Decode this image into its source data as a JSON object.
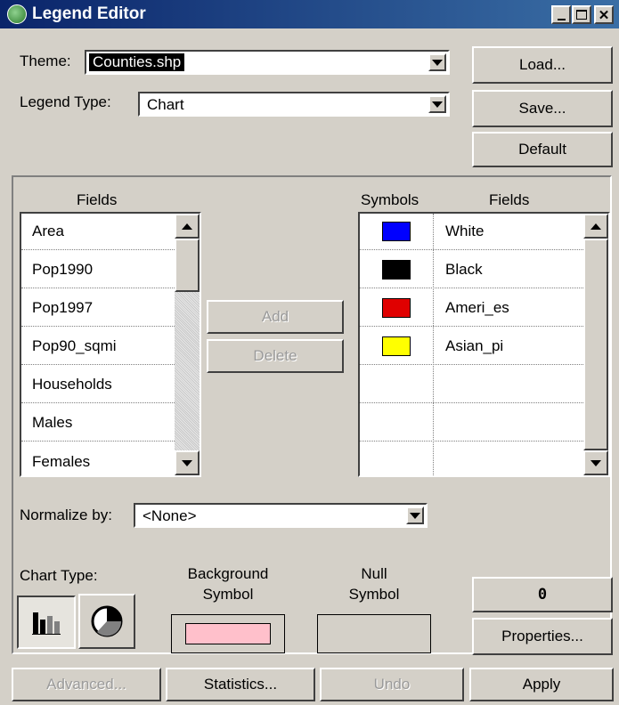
{
  "window": {
    "title": "Legend Editor",
    "accent": "#0a246a"
  },
  "theme": {
    "label": "Theme:",
    "value": "Counties.shp"
  },
  "legend_type": {
    "label": "Legend Type:",
    "value": "Chart"
  },
  "top_buttons": {
    "load": "Load...",
    "save": "Save...",
    "default": "Default"
  },
  "fields_panel": {
    "header": "Fields",
    "items": [
      "Area",
      "Pop1990",
      "Pop1997",
      "Pop90_sqmi",
      "Households",
      "Males",
      "Females"
    ]
  },
  "middle_buttons": {
    "add": "Add",
    "delete": "Delete"
  },
  "symbols_panel": {
    "symbols_header": "Symbols",
    "fields_header": "Fields",
    "rows": [
      {
        "color": "#0000ff",
        "field": "White"
      },
      {
        "color": "#000000",
        "field": "Black"
      },
      {
        "color": "#e00000",
        "field": "Ameri_es"
      },
      {
        "color": "#ffff00",
        "field": "Asian_pi"
      },
      {
        "color": "",
        "field": ""
      },
      {
        "color": "",
        "field": ""
      },
      {
        "color": "",
        "field": ""
      }
    ]
  },
  "normalize": {
    "label": "Normalize by:",
    "value": "<None>"
  },
  "chart_type": {
    "label": "Chart Type:",
    "bar_icon": "bar-chart-icon",
    "pie_icon": "pie-chart-icon"
  },
  "background_symbol": {
    "label_line1": "Background",
    "label_line2": "Symbol",
    "color": "#ffc0cb"
  },
  "null_symbol": {
    "label_line1": "Null",
    "label_line2": "Symbol"
  },
  "value_box": "0",
  "properties_button": "Properties...",
  "bottom_buttons": {
    "advanced": "Advanced...",
    "statistics": "Statistics...",
    "undo": "Undo",
    "apply": "Apply"
  }
}
